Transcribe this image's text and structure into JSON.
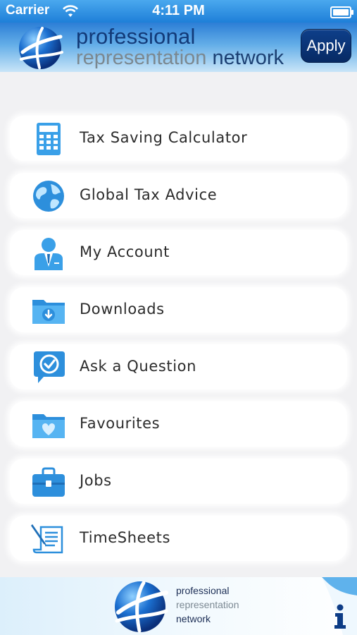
{
  "status_bar": {
    "carrier": "Carrier",
    "time": "4:11 PM",
    "icons": [
      "wifi-icon",
      "battery-icon"
    ]
  },
  "header": {
    "brand_line1": "professional",
    "brand_line2a": "representation",
    "brand_line2b": "network",
    "apply_label": "Apply"
  },
  "menu": {
    "items": [
      {
        "label": "Tax Saving Calculator",
        "icon": "calculator-icon"
      },
      {
        "label": "Global Tax Advice",
        "icon": "globe-icon"
      },
      {
        "label": "My Account",
        "icon": "person-icon"
      },
      {
        "label": "Downloads",
        "icon": "download-folder-icon"
      },
      {
        "label": "Ask a Question",
        "icon": "question-bubble-icon"
      },
      {
        "label": "Favourites",
        "icon": "heart-folder-icon"
      },
      {
        "label": "Jobs",
        "icon": "briefcase-icon"
      },
      {
        "label": "TimeSheets",
        "icon": "timesheet-icon"
      }
    ]
  },
  "footer": {
    "line1": "professional",
    "line2": "representation",
    "line3": "network",
    "info_icon": "info-icon"
  },
  "colors": {
    "accent_blue": "#2d9be3",
    "apply_bg": "#0b3478",
    "header_top": "#2c7ed6"
  }
}
